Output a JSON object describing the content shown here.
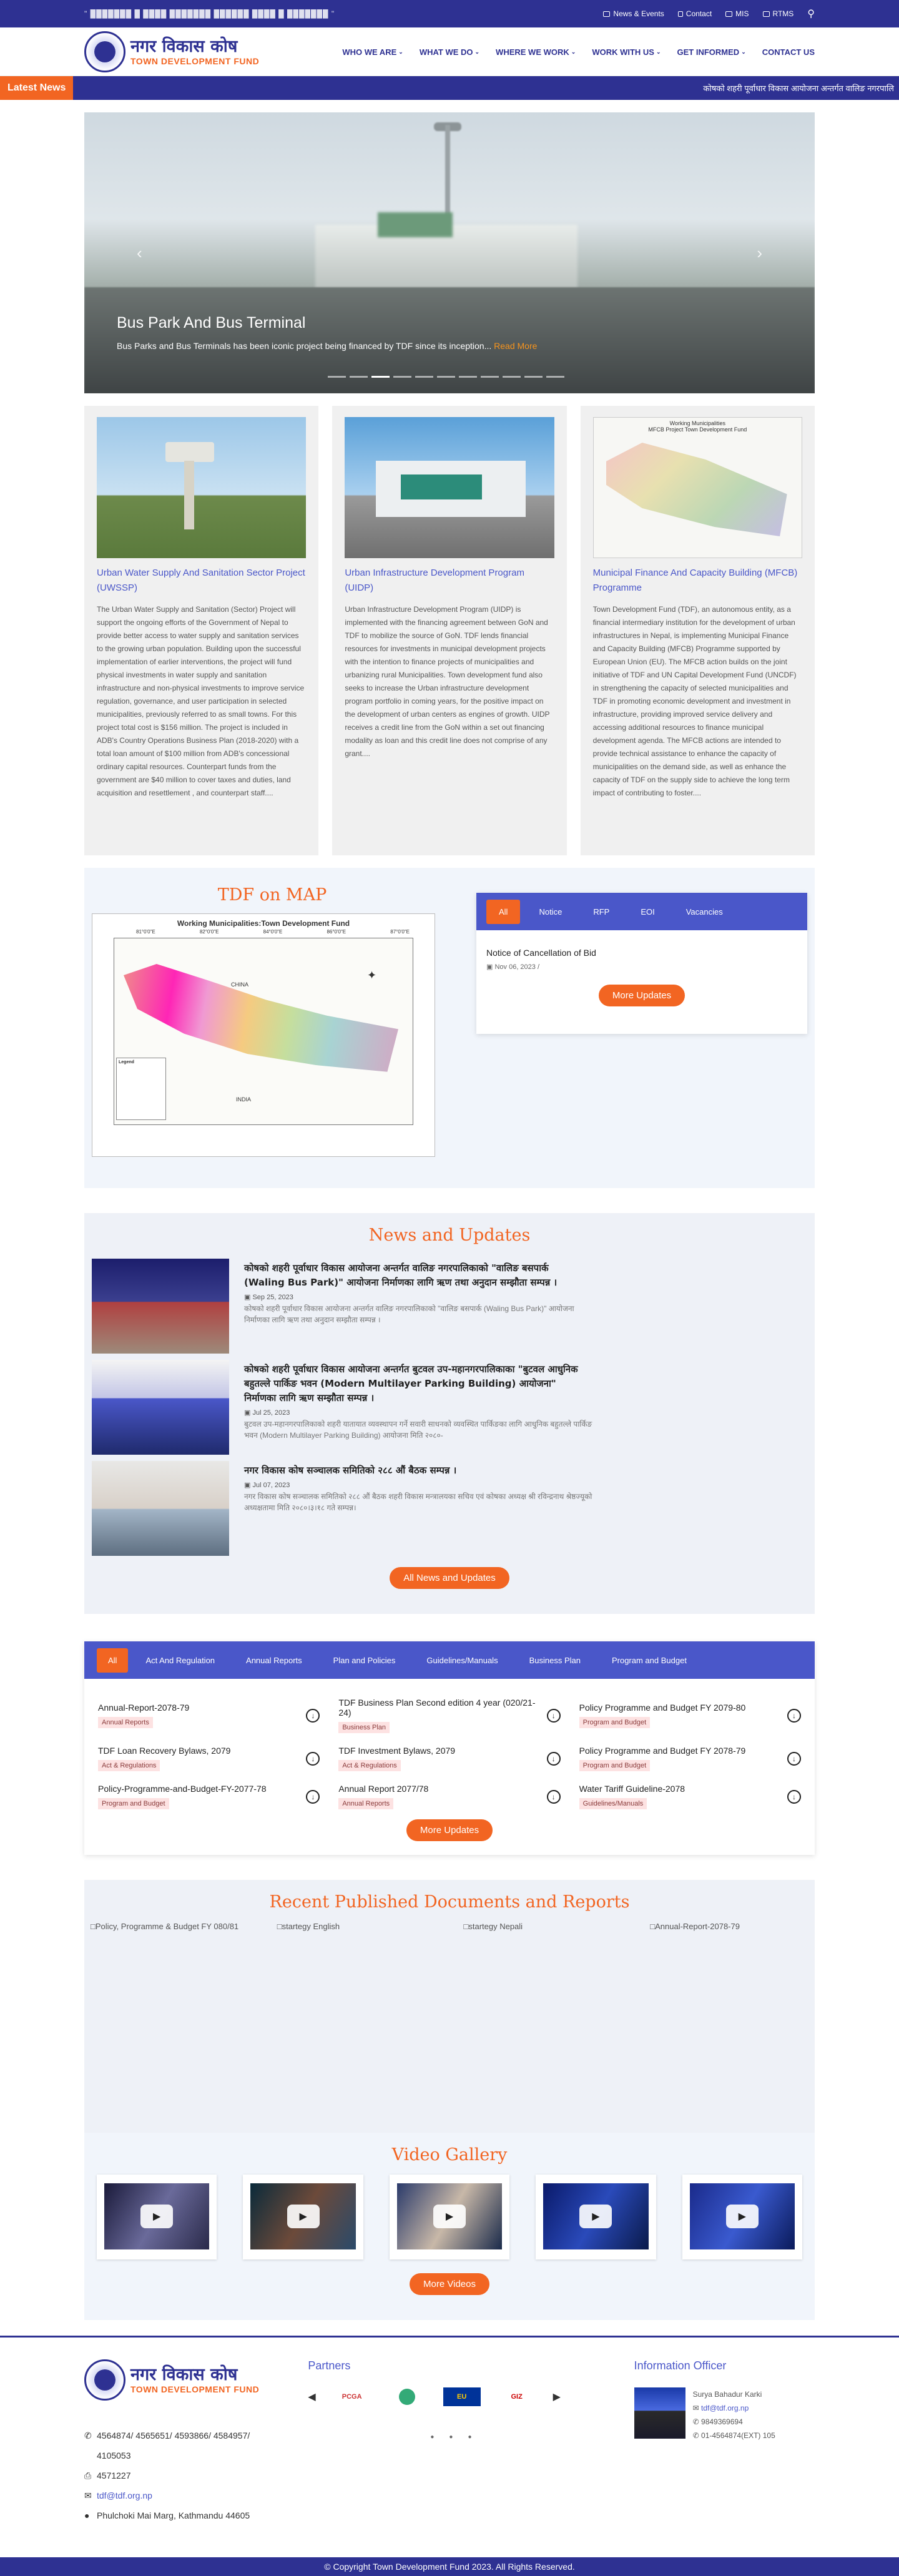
{
  "topbar": {
    "motto": "\" ███████ █ ████ ███████ ██████ ████ █ ███████ \"",
    "links": [
      "News & Events",
      "Contact",
      "MIS",
      "RTMS"
    ]
  },
  "header": {
    "logo_np": "नगर विकास कोष",
    "logo_en": "TOWN DEVELOPMENT FUND",
    "nav": [
      "WHO WE ARE",
      "WHAT WE DO",
      "WHERE WE WORK",
      "WORK WITH US",
      "GET INFORMED",
      "CONTACT US"
    ]
  },
  "ticker": {
    "label": "Latest News",
    "text": "कोषको शहरी पूर्वाधार विकास आयोजना अन्तर्गत वालिङ नगरपालि"
  },
  "hero": {
    "title": "Bus Park And Bus Terminal",
    "text": "Bus Parks and Bus Terminals has been iconic project being financed by TDF since its inception...",
    "more": "Read More",
    "slides": 11,
    "active_slide": 2
  },
  "programs": [
    {
      "title": "Urban Water Supply And Sanitation Sector Project (UWSSP)",
      "desc": "The Urban Water Supply and Sanitation (Sector) Project will support the ongoing efforts of the Government of Nepal to provide better access to water supply and sanitation services to the growing urban population. Building upon the successful implementation of earlier interventions, the project will fund physical investments in water supply and sanitation infrastructure and non-physical investments to improve service regulation, governance, and user participation in selected municipalities, previously referred to as small towns. For this project total cost is $156 million. The project is included in ADB's Country Operations Business Plan (2018-2020) with a total loan amount of $100 million from ADB's concessional ordinary capital resources. Counterpart funds from the government are $40 million to cover taxes and duties, land acquisition and resettlement , and counterpart staff...."
    },
    {
      "title": "Urban Infrastructure Development Program (UIDP)",
      "desc": "Urban Infrastructure Development Program (UIDP) is implemented with the financing agreement between GoN and TDF to mobilize the source of GoN. TDF lends financial resources for investments in municipal development projects with the intention to finance projects of municipalities and urbanizing rural Municipalities. Town development fund also seeks to increase the Urban infrastructure development program portfolio in coming years, for the positive impact on the development of urban centers as engines of growth. UIDP receives a credit line from the GoN within a set out financing modality as loan and this credit line does not comprise of any grant...."
    },
    {
      "title": "Municipal Finance And Capacity Building (MFCB) Programme",
      "desc": "Town Development Fund (TDF), an autonomous entity, as a financial intermediary institution for the development of urban infrastructures in Nepal, is implementing Municipal Finance and Capacity Building (MFCB) Programme supported by European Union (EU). The MFCB action builds on the joint initiative of TDF and UN Capital Development Fund (UNCDF) in strengthening the capacity of selected municipalities and TDF in promoting economic development and investment in infrastructure, providing improved service delivery and accessing additional resources to finance municipal development agenda. The MFCB actions are intended to provide technical assistance to enhance the capacity of municipalities on the demand side, as well as enhance the capacity of TDF on the supply side to achieve the long term impact of contributing to foster....",
      "map_title": "Working Municipalities\nMFCB Project Town Development Fund"
    }
  ],
  "map_section": {
    "title": "TDF on MAP",
    "map_title": "Working Municipalities:Town Development Fund",
    "lon_ticks": [
      "81°0'0\"E",
      "82°0'0\"E",
      "84°0'0\"E",
      "86°0'0\"E",
      "87°0'0\"E"
    ],
    "labels": [
      "CHINA",
      "INDIA",
      "Legend"
    ]
  },
  "notices": {
    "tabs": [
      "All",
      "Notice",
      "RFP",
      "EOI",
      "Vacancies"
    ],
    "active_tab": "All",
    "items": [
      {
        "title": "Notice of Cancellation of Bid",
        "date": "Nov 06, 2023 /"
      }
    ],
    "button": "More Updates"
  },
  "news": {
    "title": "News and Updates",
    "items": [
      {
        "headline": "कोषको शहरी पूर्वाधार विकास आयोजना अन्तर्गत वालिङ नगरपालिकाको \"वालिङ बसपार्क (Waling Bus Park)\" आयोजना निर्माणका लागि ऋण तथा अनुदान सम्झौता सम्पन्न ।",
        "date": "Sep 25, 2023",
        "summary": "कोषको शहरी पूर्वाधार विकास आयोजना अन्तर्गत वालिङ नगरपालिकाको \"वालिङ बसपार्क (Waling Bus Park)\" आयोजना निर्माणका लागि ऋण तथा अनुदान सम्झौता सम्पन्न ।"
      },
      {
        "headline": "कोषको शहरी पूर्वाधार विकास आयोजना अन्तर्गत बुटवल उप-महानगरपालिकाका \"बुटवल आधुनिक बहुतल्ले पार्किङ भवन (Modern Multilayer Parking Building) आयोजना\" निर्माणका लागि ऋण सम्झौता सम्पन्न ।",
        "date": "Jul 25, 2023",
        "summary": "बुटवल उप-महानगरपालिकाको शहरी यातायात व्यवस्थापन गर्ने सवारी साधनको व्यवस्थित पार्किङका लागि आधुनिक बहुतल्ले पार्किङ भवन (Modern Multilayer Parking Building) आयोजना मिति २०८०-"
      },
      {
        "headline": "नगर विकास कोष सञ्चालक समितिको २८८ औं बैठक सम्पन्न ।",
        "date": "Jul 07, 2023",
        "summary": "नगर विकास कोष सञ्चालक समितिको २८८ औं बैठक शहरी विकास मन्त्रालयका सचिव एवं कोषका अध्यक्ष श्री रविन्द्रनाथ श्रेष्ठज्यूको अध्यक्षतामा मिति २०८०।३।१८ गते सम्पन्न।"
      }
    ],
    "button": "All News and Updates"
  },
  "documents": {
    "tabs": [
      "All",
      "Act And Regulation",
      "Annual Reports",
      "Plan and Policies",
      "Guidelines/Manuals",
      "Business Plan",
      "Program and Budget"
    ],
    "active_tab": "All",
    "items": [
      {
        "title": "Annual-Report-2078-79",
        "tag": "Annual Reports"
      },
      {
        "title": "TDF Business Plan Second edition 4 year (020/21-24)",
        "tag": "Business Plan"
      },
      {
        "title": "Policy Programme and Budget FY 2079-80",
        "tag": "Program and Budget"
      },
      {
        "title": "TDF Loan Recovery Bylaws, 2079",
        "tag": "Act & Regulations"
      },
      {
        "title": "TDF Investment Bylaws, 2079",
        "tag": "Act & Regulations"
      },
      {
        "title": "Policy Programme and Budget FY 2078-79",
        "tag": "Program and Budget"
      },
      {
        "title": "Policy-Programme-and-Budget-FY-2077-78",
        "tag": "Program and Budget"
      },
      {
        "title": "Annual Report 2077/78",
        "tag": "Annual Reports"
      },
      {
        "title": "Water Tariff Guideline-2078",
        "tag": "Guidelines/Manuals"
      }
    ],
    "button": "More Updates"
  },
  "recent": {
    "title": "Recent Published Documents and Reports",
    "items": [
      "Policy, Programme & Budget FY 080/81",
      "startegy English",
      "startegy Nepali",
      "Annual-Report-2078-79"
    ]
  },
  "video": {
    "title": "Video Gallery",
    "count": 5,
    "button": "More Videos"
  },
  "footer": {
    "phones": "4564874/ 4565651/ 4593866/ 4584957/ 4105053",
    "fax": "4571227",
    "email": "tdf@tdf.org.np",
    "address": "Phulchoki Mai Marg, Kathmandu 44605",
    "partners_title": "Partners",
    "partners": [
      "PCGA",
      "EU",
      "GIZ"
    ],
    "officer_title": "Information Officer",
    "officer_name": "Surya Bahadur Karki",
    "officer_email": "tdf@tdf.org.np",
    "officer_phone": "9849369694",
    "officer_office": "01-4564874(EXT) 105",
    "copyright": "© Copyright Town Development Fund 2023. All Rights Reserved."
  },
  "colors": {
    "primary": "#2e3192",
    "accent": "#f26522",
    "link": "#4a57c9"
  }
}
